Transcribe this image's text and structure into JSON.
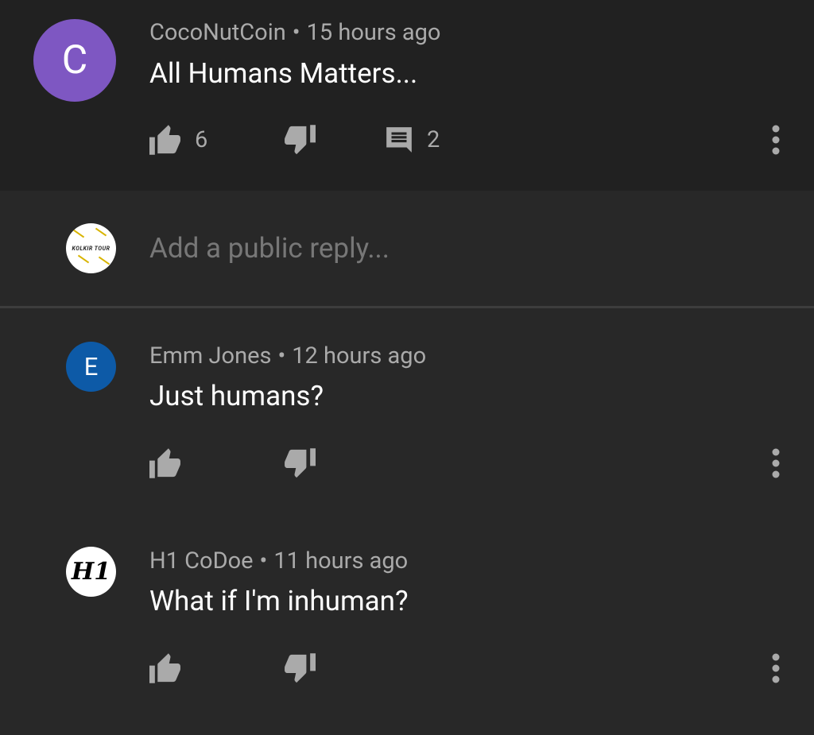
{
  "parent": {
    "avatar_letter": "C",
    "author": "CocoNutCoin",
    "separator": "•",
    "time": "15 hours ago",
    "text": "All Humans Matters...",
    "like_count": "6",
    "reply_count": "2"
  },
  "reply_box": {
    "placeholder": "Add a public reply...",
    "avatar_text": "KOLKIR TOUR"
  },
  "replies": [
    {
      "avatar_letter": "E",
      "author": "Emm Jones",
      "separator": "•",
      "time": "12 hours ago",
      "text": "Just humans?"
    },
    {
      "avatar_letter": "H1",
      "author": "H1 CoDoe",
      "separator": "•",
      "time": "11 hours ago",
      "text": "What if I'm inhuman?"
    }
  ],
  "icons": {
    "like": "thumb-up-icon",
    "dislike": "thumb-down-icon",
    "reply": "comment-icon",
    "more": "more-vert-icon"
  }
}
